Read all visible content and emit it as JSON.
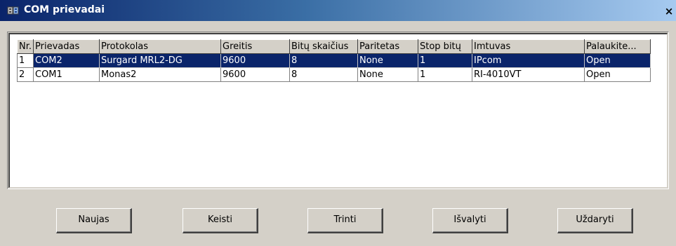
{
  "window": {
    "title": "COM prievadai",
    "close_glyph": "×"
  },
  "table": {
    "columns": [
      "Nr.",
      "Prievadas",
      "Protokolas",
      "Greitis",
      "Bitų skaičius",
      "Paritetas",
      "Stop bitų",
      "Imtuvas",
      "Palaukite..."
    ],
    "rows": [
      {
        "nr": "1",
        "prievadas": "COM2",
        "protokolas": "Surgard MRL2-DG",
        "greitis": "9600",
        "bitu": "8",
        "paritetas": "None",
        "stop": "1",
        "imtuvas": "IPcom",
        "palaukite": "Open",
        "selected": true
      },
      {
        "nr": "2",
        "prievadas": "COM1",
        "protokolas": "Monas2",
        "greitis": "9600",
        "bitu": "8",
        "paritetas": "None",
        "stop": "1",
        "imtuvas": "RI-4010VT",
        "palaukite": "Open",
        "selected": false
      }
    ]
  },
  "buttons": {
    "new": "Naujas",
    "edit": "Keisti",
    "delete": "Trinti",
    "clear": "Išvalyti",
    "close": "Uždaryti"
  },
  "colors": {
    "selection": "#0a246a",
    "face": "#d4d0c8"
  },
  "icons": {
    "title": "network-ports-icon",
    "close": "close-icon"
  }
}
